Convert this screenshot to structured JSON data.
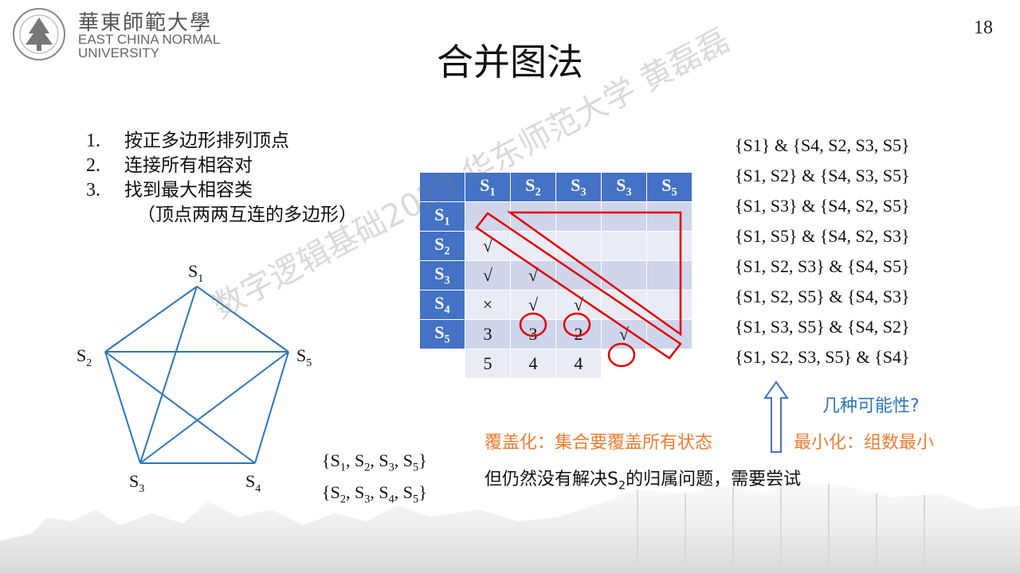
{
  "header": {
    "univ_cn": "華東師範大學",
    "univ_en1": "EAST CHINA NORMAL",
    "univ_en2": "UNIVERSITY",
    "page_number": "18"
  },
  "title": "合并图法",
  "steps": [
    {
      "num": "1.",
      "text": "按正多边形排列顶点"
    },
    {
      "num": "2.",
      "text": "连接所有相容对"
    },
    {
      "num": "3.",
      "text": "找到最大相容类"
    }
  ],
  "step_note": "（顶点两两互连的多边形）",
  "pentagon": {
    "labels": {
      "s1": "S",
      "s2": "S",
      "s3": "S",
      "s4": "S",
      "s5": "S"
    },
    "subs": {
      "s1": "1",
      "s2": "2",
      "s3": "3",
      "s4": "4",
      "s5": "5"
    },
    "line_color": "#2e75b6"
  },
  "sets_below": [
    [
      "S",
      "1",
      "S",
      "2",
      "S",
      "3",
      "S",
      "5"
    ],
    [
      "S",
      "2",
      "S",
      "3",
      "S",
      "4",
      "S",
      "5"
    ]
  ],
  "table": {
    "col_headers": [
      {
        "t": "S",
        "s": "1"
      },
      {
        "t": "S",
        "s": "2"
      },
      {
        "t": "S",
        "s": "3"
      },
      {
        "t": "S",
        "s": "3"
      },
      {
        "t": "S",
        "s": "5"
      }
    ],
    "row_headers": [
      {
        "t": "S",
        "s": "1"
      },
      {
        "t": "S",
        "s": "2"
      },
      {
        "t": "S",
        "s": "3"
      },
      {
        "t": "S",
        "s": "4"
      },
      {
        "t": "S",
        "s": "5"
      }
    ],
    "rows": [
      [
        "",
        "",
        "",
        "",
        ""
      ],
      [
        "√",
        "",
        "",
        "",
        ""
      ],
      [
        "√",
        "√",
        "",
        "",
        ""
      ],
      [
        "×",
        "√",
        "√",
        "",
        ""
      ],
      [
        "3",
        "3",
        "2",
        "√",
        ""
      ]
    ],
    "extra_row": [
      "5",
      "4",
      "4"
    ],
    "circled": [
      "3-1",
      "3-2",
      "4-3"
    ],
    "header_color": "#4472c4",
    "highlight_color": "#e00000"
  },
  "pairs": [
    "{S1} & {S4, S2, S3, S5}",
    "{S1, S2} & {S4, S3, S5}",
    "{S1, S3} & {S4, S2, S5}",
    "{S1, S5} & {S4, S2, S3}",
    "{S1, S2, S3} & {S4, S5}",
    "{S1, S2, S5} & {S4, S3}",
    "{S1, S3, S5} & {S4, S2}",
    "{S1, S2, S3, S5} & {S4}"
  ],
  "possibilities": "几种可能性?",
  "cover": "覆盖化：集合要覆盖所有状态",
  "minimize": "最小化：组数最小",
  "conclusion_pre": "但仍然没有解决S",
  "conclusion_sub": "2",
  "conclusion_post": "的归属问题，需要尝试",
  "watermark": "数字逻辑基础2023 华东师范大学 黄磊磊",
  "colors": {
    "blue_text": "#2e75b6",
    "orange_text": "#ed7d31"
  }
}
